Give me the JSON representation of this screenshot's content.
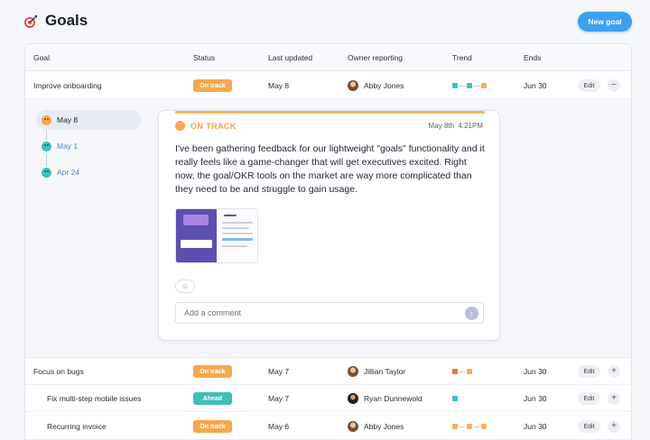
{
  "header": {
    "title": "Goals",
    "new_goal_label": "New goal"
  },
  "table": {
    "columns": [
      "Goal",
      "Status",
      "Last updated",
      "Owner reporting",
      "Trend",
      "Ends"
    ],
    "rows": [
      {
        "goal": "Improve onboarding",
        "status": "On track",
        "updated": "May 8",
        "owner": "Abby Jones",
        "ends": "Jun 30",
        "edit": "Edit",
        "toggle": "−",
        "trend": [
          "#3fc1c0",
          "#3fc1c0",
          "#f5ae5b"
        ]
      },
      {
        "goal": "Focus on bugs",
        "status": "On track",
        "updated": "May 7",
        "owner": "Jillian Taylor",
        "ends": "Jun 30",
        "edit": "Edit",
        "toggle": "+",
        "trend": [
          "#f0774a",
          "#f5ae5b"
        ]
      },
      {
        "goal": "Fix multi-step mobile issues",
        "status": "Ahead",
        "updated": "May 7",
        "owner": "Ryan Dunnewold",
        "ends": "Jun 30",
        "edit": "Edit",
        "toggle": "+",
        "trend": [
          "#3fc1c0"
        ]
      },
      {
        "goal": "Recurring invoice",
        "status": "On track",
        "updated": "May 6",
        "owner": "Abby Jones",
        "ends": "Jun 30",
        "edit": "Edit",
        "toggle": "+",
        "trend": [
          "#f5ae5b",
          "#f5ae5b",
          "#f5ae5b"
        ]
      }
    ]
  },
  "timeline": [
    {
      "date": "May 8",
      "color": "#f6a84f"
    },
    {
      "date": "May 1",
      "color": "#3fc1c0"
    },
    {
      "date": "Apr 24",
      "color": "#3fc1c0"
    }
  ],
  "update": {
    "status": "ON TRACK",
    "date": "May 8th",
    "time": "4:21PM",
    "body": "I've been gathering feedback for our lightweight \"goals\" functionality and it really feels like a game-changer that will get executives excited. Right now, the goal/OKR tools on the market are way more complicated than they need to be and struggle to gain usage.",
    "comment_placeholder": "Add a comment"
  },
  "colors": {
    "on_track": "#f6a84f",
    "ahead": "#3fbfb3",
    "accent": "#3ea0ef"
  }
}
